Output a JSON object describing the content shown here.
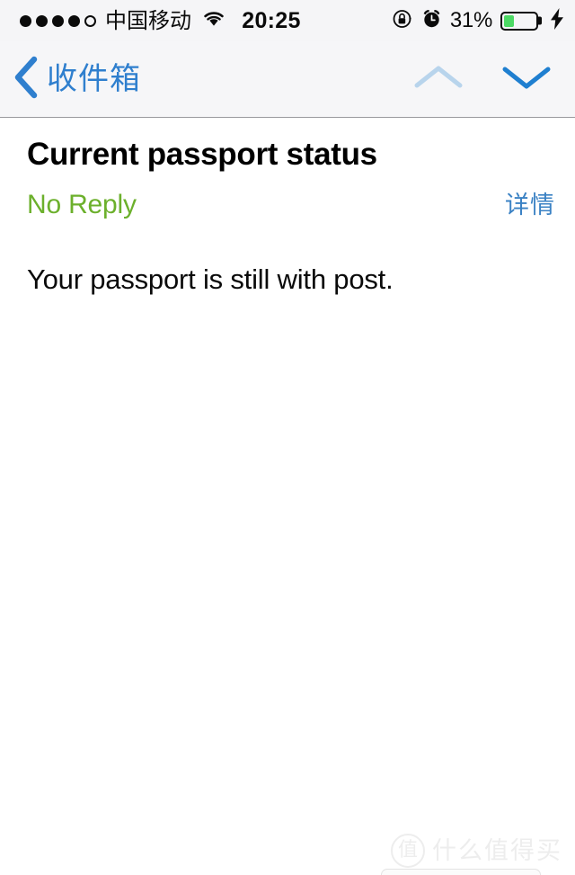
{
  "status_bar": {
    "signal_dots_filled": 4,
    "signal_dots_total": 5,
    "carrier": "中国移动",
    "wifi_icon": "wifi-icon",
    "time": "20:25",
    "rotation_lock_icon": "rotation-lock-icon",
    "alarm_icon": "alarm-clock-icon",
    "battery_percent": "31%",
    "battery_level": 31,
    "battery_icon": "battery-icon",
    "charging_icon": "lightning-bolt-icon",
    "battery_fill_color": "#4cd964"
  },
  "nav_bar": {
    "back_icon": "chevron-left-icon",
    "back_label": "收件箱",
    "previous_message_icon": "chevron-up-icon",
    "next_message_icon": "chevron-down-icon",
    "previous_enabled": false,
    "next_enabled": true,
    "active_color": "#2f7fce",
    "disabled_color": "#b8d4ec",
    "background": "#f6f6f8"
  },
  "message": {
    "subject": "Current passport status",
    "sender": "No Reply",
    "sender_color": "#6cb02c",
    "details_label": "详情",
    "details_color": "#3b82c4",
    "body": "Your passport is still with post."
  },
  "watermark": {
    "logo_glyph": "值",
    "text": "什么值得买",
    "color": "#dcdcdc"
  }
}
